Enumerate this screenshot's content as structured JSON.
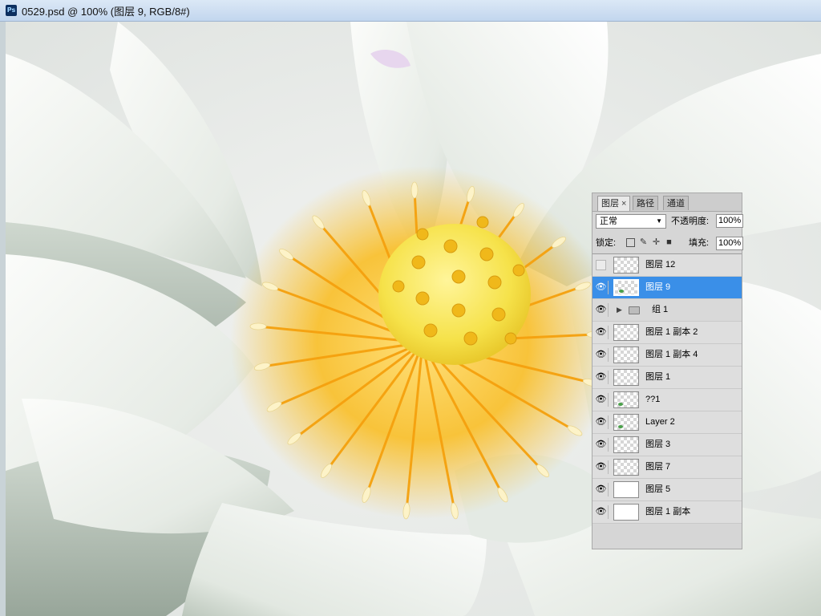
{
  "window": {
    "app_icon": "photoshop-icon",
    "title": "0529.psd @ 100% (图层 9, RGB/8#)"
  },
  "layers_panel": {
    "tabs": [
      {
        "label": "图层",
        "close": "×",
        "active": true
      },
      {
        "label": "路径",
        "active": false
      },
      {
        "label": "通道",
        "active": false
      }
    ],
    "blend_mode": "正常",
    "opacity_label": "不透明度:",
    "opacity_value": "100%",
    "lock_label": "锁定:",
    "lock_icons": [
      "lock-transparent-icon",
      "lock-brush-icon",
      "lock-move-icon",
      "lock-all-icon"
    ],
    "fill_label": "填充:",
    "fill_value": "100%",
    "layers": [
      {
        "name": "图层 12",
        "visible": false,
        "selected": false,
        "type": "layer"
      },
      {
        "name": "图层 9",
        "visible": true,
        "selected": true,
        "type": "layer"
      },
      {
        "name": "组 1",
        "visible": true,
        "selected": false,
        "type": "group"
      },
      {
        "name": "图层 1 副本 2",
        "visible": true,
        "selected": false,
        "type": "layer"
      },
      {
        "name": "图层 1 副本 4",
        "visible": true,
        "selected": false,
        "type": "layer"
      },
      {
        "name": "图层 1",
        "visible": true,
        "selected": false,
        "type": "layer"
      },
      {
        "name": "??1",
        "visible": true,
        "selected": false,
        "type": "layer"
      },
      {
        "name": "Layer 2",
        "visible": true,
        "selected": false,
        "type": "layer"
      },
      {
        "name": "图层 3",
        "visible": true,
        "selected": false,
        "type": "layer"
      },
      {
        "name": "图层 7",
        "visible": true,
        "selected": false,
        "type": "layer"
      },
      {
        "name": "图层 5",
        "visible": true,
        "selected": false,
        "type": "layer"
      },
      {
        "name": "图层 1 副本",
        "visible": true,
        "selected": false,
        "type": "layer"
      }
    ]
  },
  "colors": {
    "selection_blue": "#3a8fe8",
    "petal_white": "#eef2ee",
    "stamen_orange": "#f5a10e",
    "pod_yellow": "#f7e34a"
  }
}
